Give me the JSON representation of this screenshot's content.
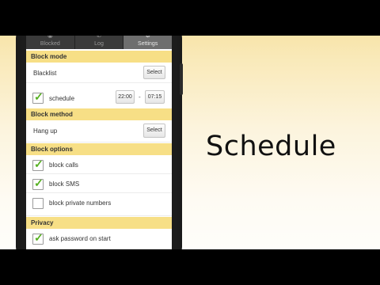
{
  "headline": "Schedule",
  "tabs": [
    {
      "label": "Blocked",
      "icon": "shield-icon"
    },
    {
      "label": "Log",
      "icon": "phone-icon"
    },
    {
      "label": "Settings",
      "icon": "gear-icon",
      "active": true
    }
  ],
  "sections": {
    "block_mode": {
      "title": "Block mode",
      "mode_label": "Blacklist",
      "select_label": "Select",
      "schedule_label": "schedule",
      "schedule_checked": true,
      "start_time": "22:00",
      "time_separator": "-",
      "end_time": "07:15"
    },
    "block_method": {
      "title": "Block method",
      "method_label": "Hang up",
      "select_label": "Select"
    },
    "block_options": {
      "title": "Block options",
      "items": [
        {
          "label": "block calls",
          "checked": true
        },
        {
          "label": "block SMS",
          "checked": true
        },
        {
          "label": "block private numbers",
          "checked": false
        }
      ]
    },
    "privacy": {
      "title": "Privacy",
      "items": [
        {
          "label": "ask password on start",
          "checked": true
        }
      ]
    }
  },
  "colors": {
    "section_header": "#f7df86",
    "check": "#55b020",
    "background_top": "#f6dc93"
  }
}
